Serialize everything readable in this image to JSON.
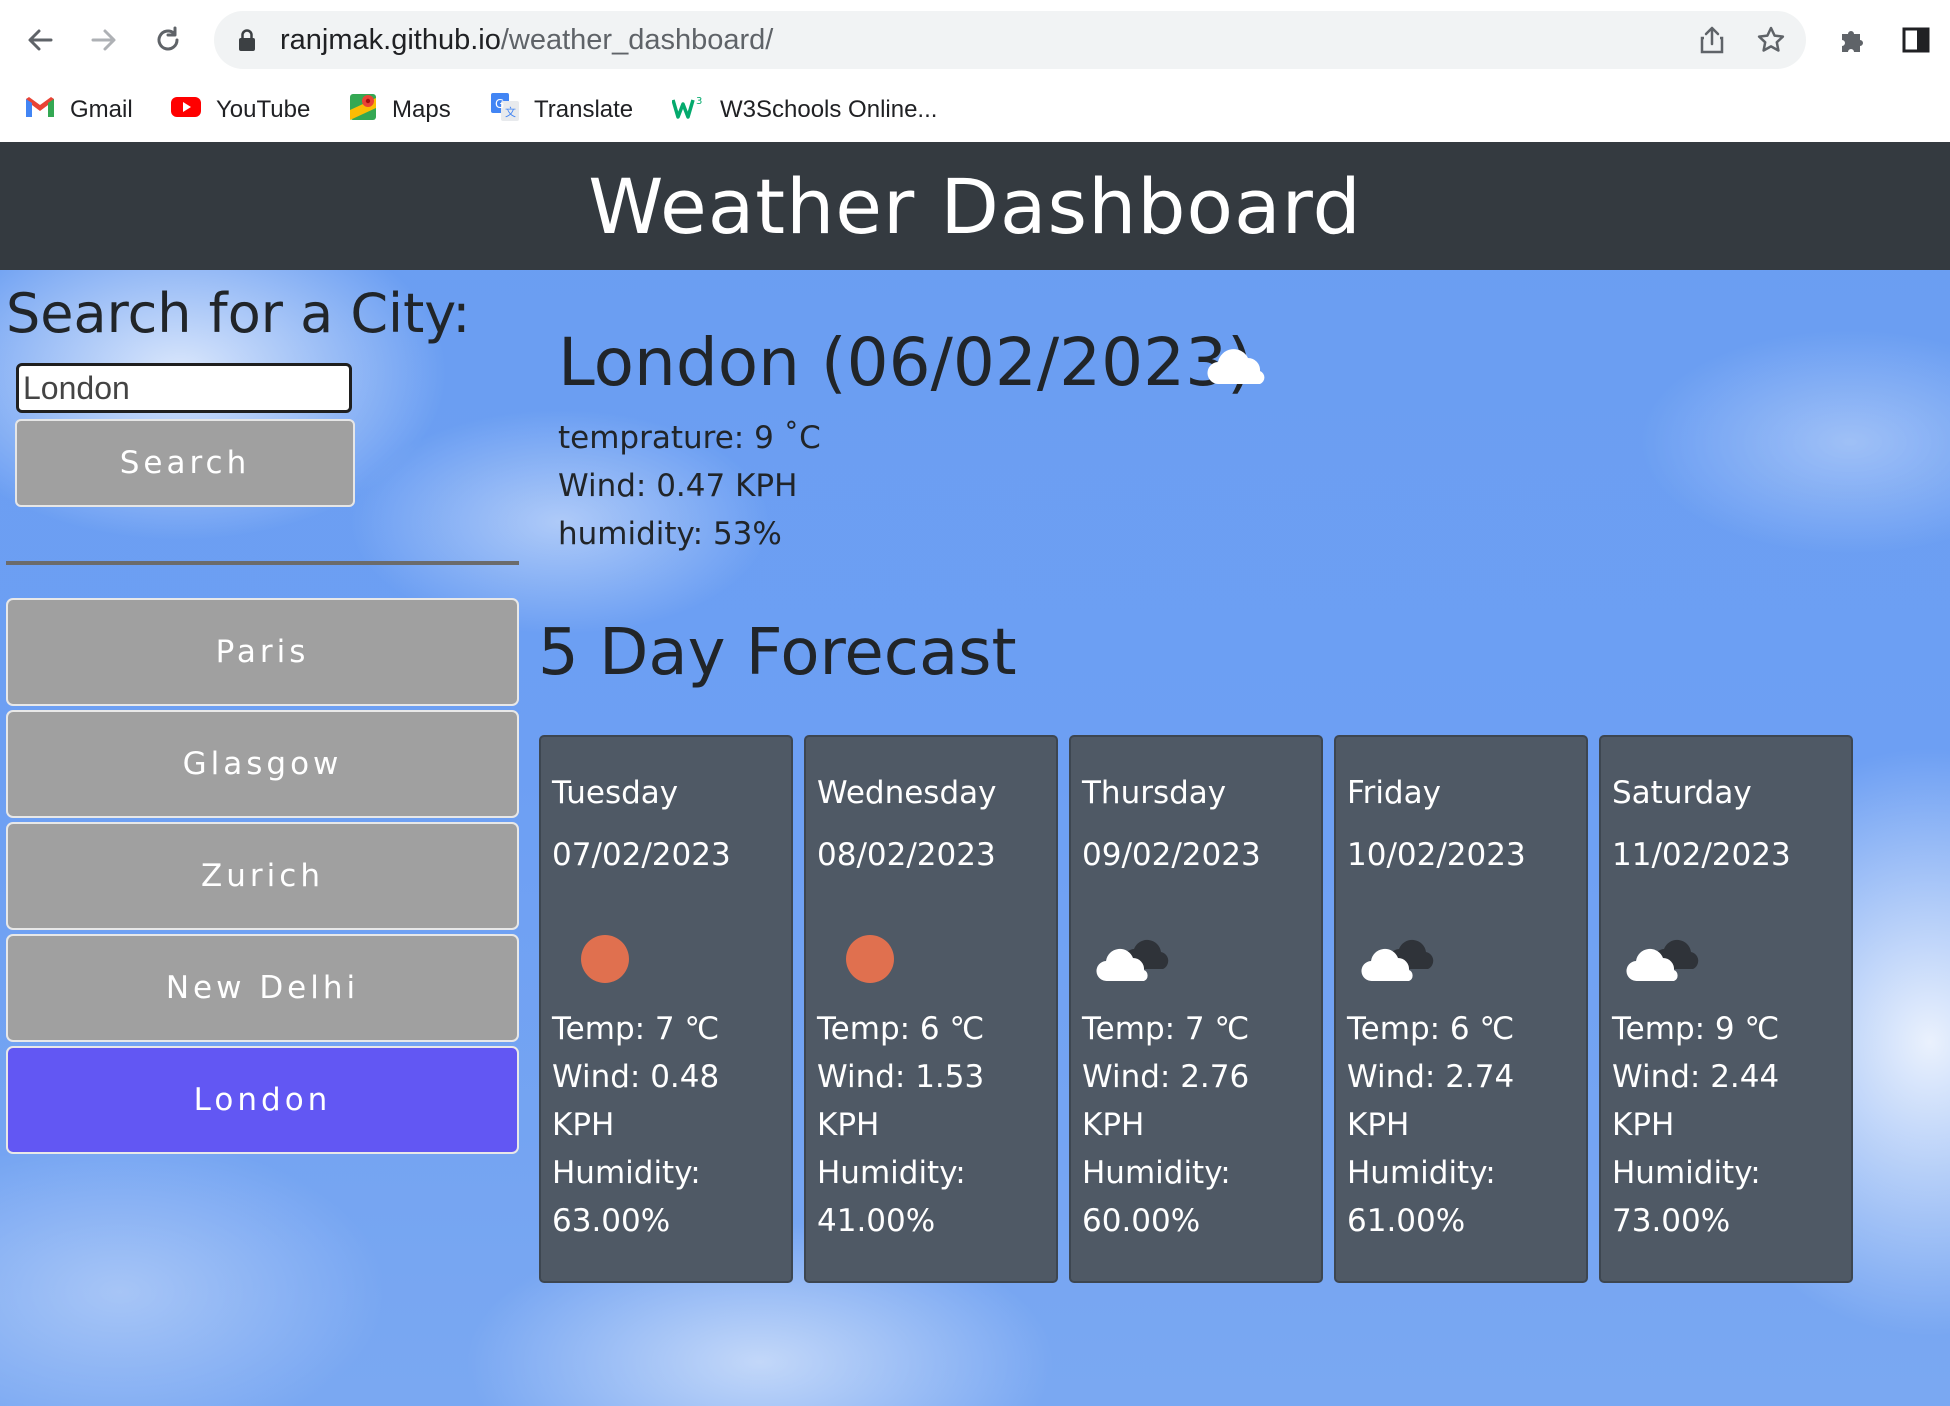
{
  "browser": {
    "url_host": "ranjmak.github.io",
    "url_path": "/weather_dashboard/",
    "bookmarks": [
      {
        "label": "Gmail",
        "icon": "gmail-icon"
      },
      {
        "label": "YouTube",
        "icon": "youtube-icon"
      },
      {
        "label": "Maps",
        "icon": "maps-icon"
      },
      {
        "label": "Translate",
        "icon": "translate-icon"
      },
      {
        "label": "W3Schools Online...",
        "icon": "w3schools-icon"
      }
    ]
  },
  "app": {
    "title": "Weather Dashboard",
    "accent_color": "#6257f3",
    "header_color": "#343a40"
  },
  "search": {
    "label": "Search for a City:",
    "value": "London",
    "button_label": "Search"
  },
  "history": [
    {
      "label": "Paris",
      "active": false
    },
    {
      "label": "Glasgow",
      "active": false
    },
    {
      "label": "Zurich",
      "active": false
    },
    {
      "label": "New Delhi",
      "active": false
    },
    {
      "label": "London",
      "active": true
    }
  ],
  "current": {
    "title": "London (06/02/2023)",
    "icon": "cloud-icon",
    "temperature": "temprature: 9 ˚C",
    "wind": "Wind: 0.47 KPH",
    "humidity": "humidity: 53%"
  },
  "forecast": {
    "title": "5 Day Forecast",
    "days": [
      {
        "day": "Tuesday",
        "date": "07/02/2023",
        "icon": "sun-icon",
        "temp": "Temp: 7 ℃",
        "wind": "Wind: 0.48 KPH",
        "humidity": "Humidity: 63.00%"
      },
      {
        "day": "Wednesday",
        "date": "08/02/2023",
        "icon": "sun-icon",
        "temp": "Temp: 6 ℃",
        "wind": "Wind: 1.53 KPH",
        "humidity": "Humidity: 41.00%"
      },
      {
        "day": "Thursday",
        "date": "09/02/2023",
        "icon": "clouds-icon",
        "temp": "Temp: 7 ℃",
        "wind": "Wind: 2.76 KPH",
        "humidity": "Humidity: 60.00%"
      },
      {
        "day": "Friday",
        "date": "10/02/2023",
        "icon": "clouds-icon",
        "temp": "Temp: 6 ℃",
        "wind": "Wind: 2.74 KPH",
        "humidity": "Humidity: 61.00%"
      },
      {
        "day": "Saturday",
        "date": "11/02/2023",
        "icon": "clouds-icon",
        "temp": "Temp: 9 ℃",
        "wind": "Wind: 2.44 KPH",
        "humidity": "Humidity: 73.00%"
      }
    ]
  }
}
